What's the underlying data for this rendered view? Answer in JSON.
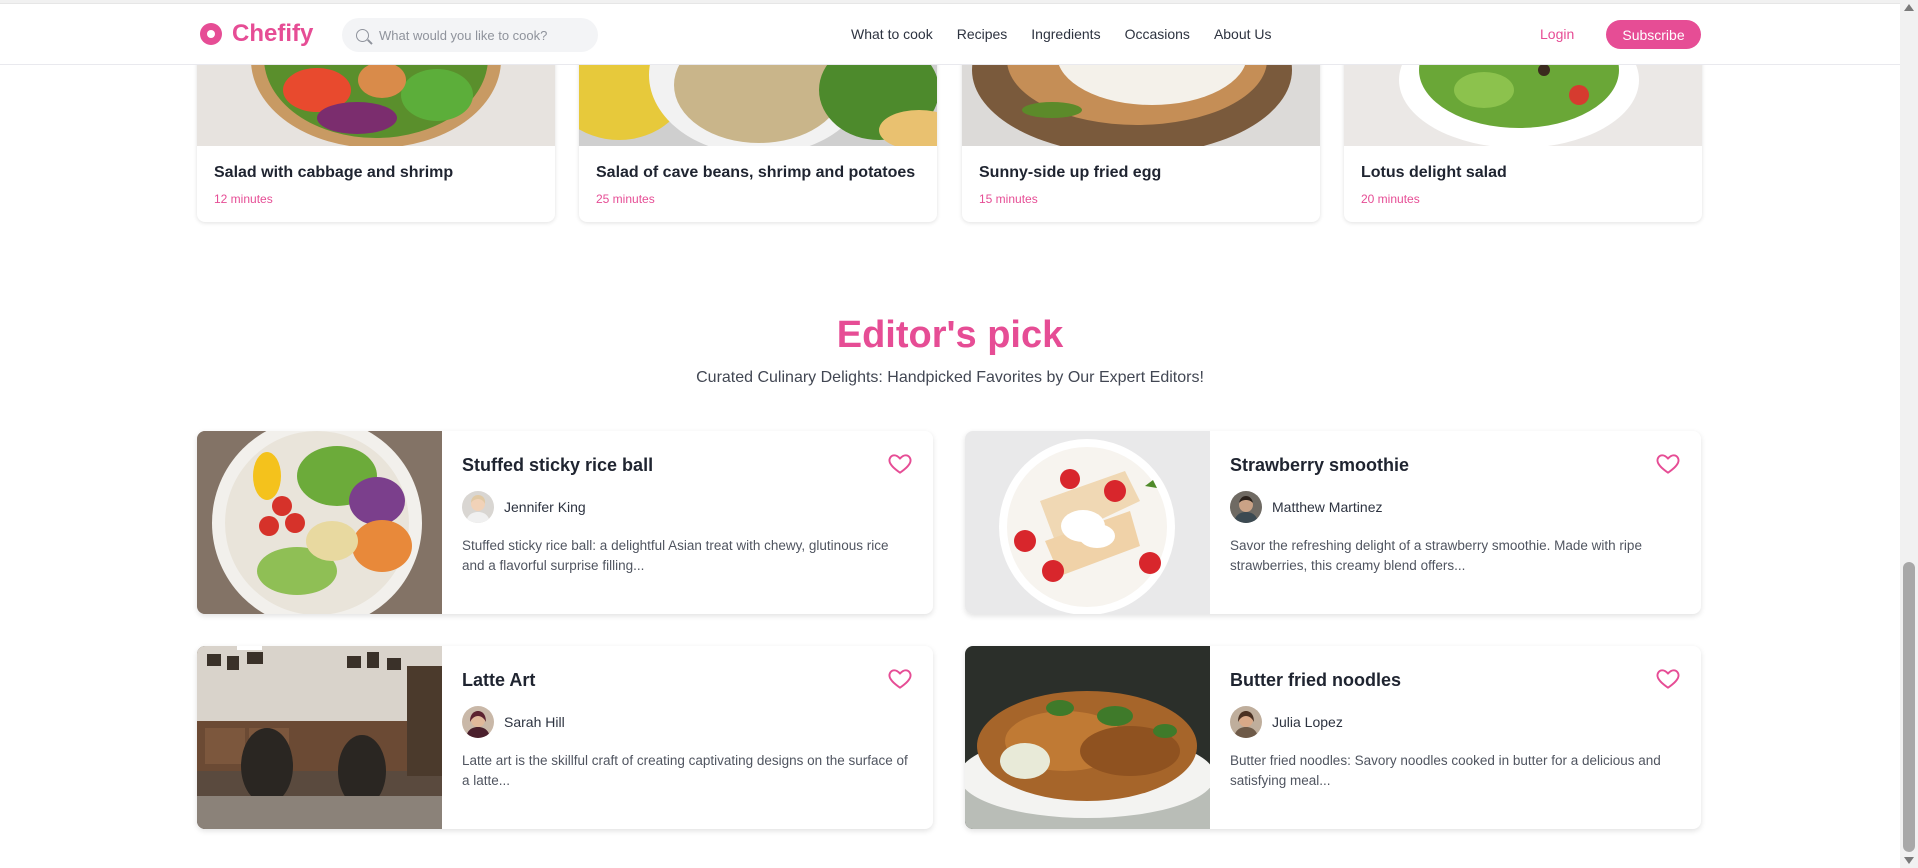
{
  "header": {
    "brand": "Chefify",
    "search_placeholder": "What would you like to cook?",
    "nav": [
      "What to cook",
      "Recipes",
      "Ingredients",
      "Occasions",
      "About Us"
    ],
    "login_label": "Login",
    "subscribe_label": "Subscribe",
    "accent_color": "#e64d95"
  },
  "recipes": [
    {
      "title": "Salad with cabbage and shrimp",
      "time": "12 minutes"
    },
    {
      "title": "Salad of cave beans, shrimp and potatoes",
      "time": "25 minutes"
    },
    {
      "title": "Sunny-side up fried egg",
      "time": "15 minutes"
    },
    {
      "title": "Lotus delight salad",
      "time": "20 minutes"
    }
  ],
  "editors_pick": {
    "title": "Editor's pick",
    "subtitle": "Curated Culinary Delights: Handpicked Favorites by Our Expert Editors!",
    "cards": [
      {
        "title": "Stuffed sticky rice ball",
        "author": "Jennifer King",
        "description": "Stuffed sticky rice ball: a delightful Asian treat with chewy, glutinous rice and a flavorful surprise filling..."
      },
      {
        "title": "Strawberry smoothie",
        "author": "Matthew Martinez",
        "description": "Savor the refreshing delight of a strawberry smoothie. Made with ripe strawberries, this creamy blend offers..."
      },
      {
        "title": "Latte Art",
        "author": "Sarah Hill",
        "description": "Latte art is the skillful craft of creating captivating designs on the surface of a latte..."
      },
      {
        "title": "Butter fried noodles",
        "author": "Julia Lopez",
        "description": "Butter fried noodles: Savory noodles cooked in butter for a delicious and satisfying meal..."
      }
    ]
  }
}
